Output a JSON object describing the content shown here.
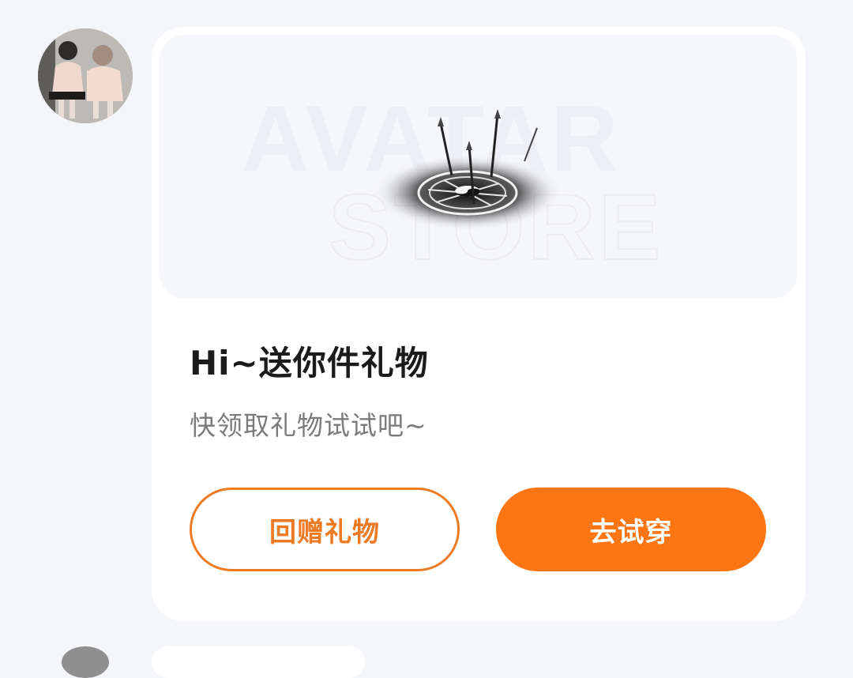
{
  "message": {
    "sender": {
      "avatar_icon": "user-photo-avatar"
    },
    "card": {
      "banner": {
        "watermark_line1": "AVATAR",
        "watermark_line2": "STORE",
        "item_icon": "magic-circle-swords"
      },
      "title": "Hi~送你件礼物",
      "subtitle": "快领取礼物试试吧~",
      "buttons": {
        "return_gift": "回赠礼物",
        "try_on": "去试穿"
      }
    }
  },
  "colors": {
    "accent": "#fe7613",
    "outline": "#ee7a24",
    "background": "#f4f6f9",
    "card": "#ffffff"
  }
}
